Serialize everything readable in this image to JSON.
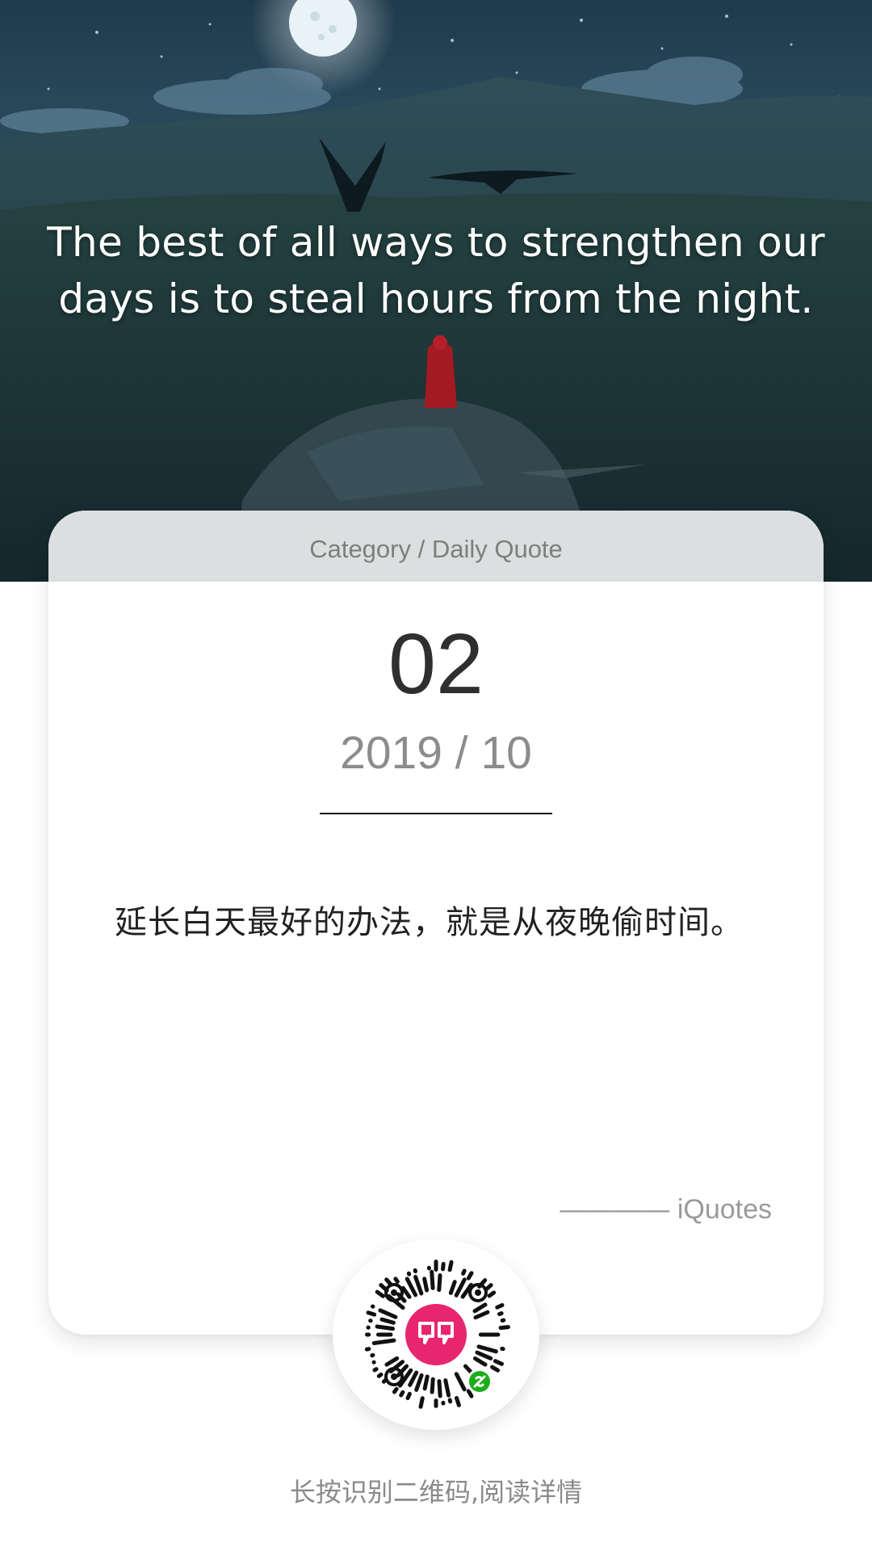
{
  "hero": {
    "quote_line1": "The best of all ways to strengthen our",
    "quote_line2": "days is to steal hours from the night."
  },
  "card": {
    "category": "Category / Daily Quote",
    "day": "02",
    "month": "2019 / 10",
    "quote_cn": "延长白天最好的办法，就是从夜晚偷时间。",
    "source": "———— iQuotes"
  },
  "footer": {
    "hint": "长按识别二维码,阅读详情"
  },
  "colors": {
    "accent_pink": "#e8266f",
    "miniprogram_green": "#1aad19"
  },
  "icons": [
    "moon-icon",
    "qr-code-icon",
    "quote-icon",
    "link-icon"
  ]
}
